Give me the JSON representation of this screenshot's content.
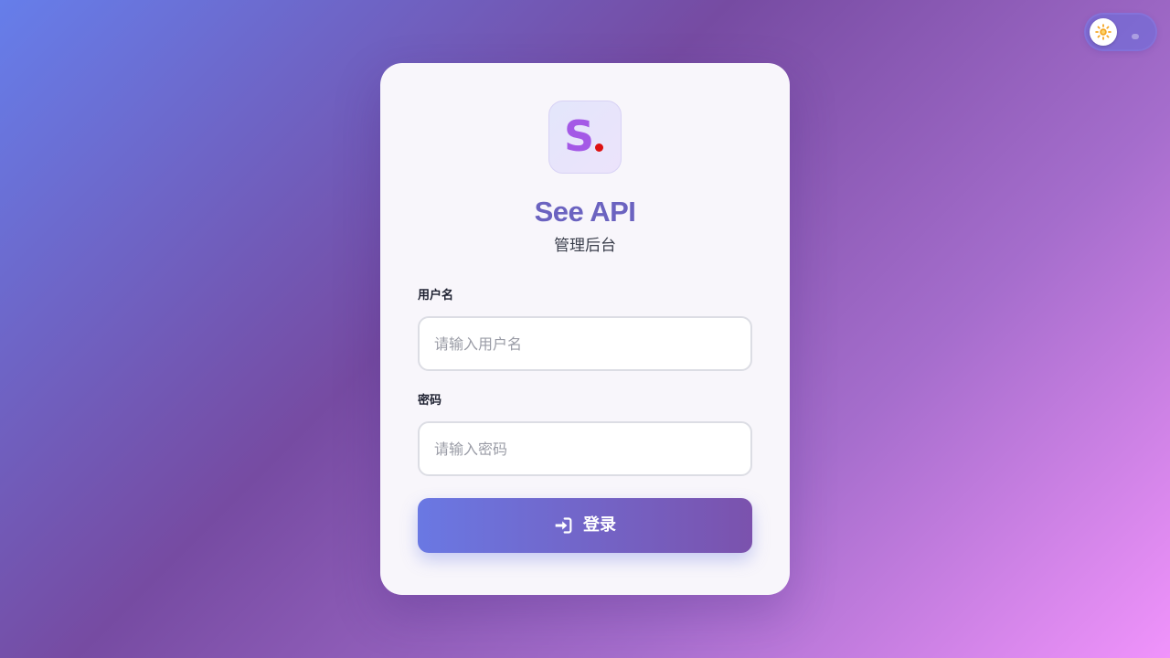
{
  "theme_toggle": {
    "icon": "sun-icon",
    "state": "light"
  },
  "brand": {
    "logo_letter": "S",
    "logo_letter_color": "#a459e6",
    "logo_dot_color": "#dd1111",
    "title": "See API",
    "subtitle": "管理后台"
  },
  "form": {
    "username": {
      "label": "用户名",
      "placeholder": "请输入用户名",
      "value": ""
    },
    "password": {
      "label": "密码",
      "placeholder": "请输入密码",
      "value": ""
    },
    "submit": {
      "icon": "sign-in-icon",
      "label": "登录"
    }
  },
  "colors": {
    "accent": "#667eea",
    "accent_dark": "#764ba2",
    "title": "#6b63c0"
  }
}
